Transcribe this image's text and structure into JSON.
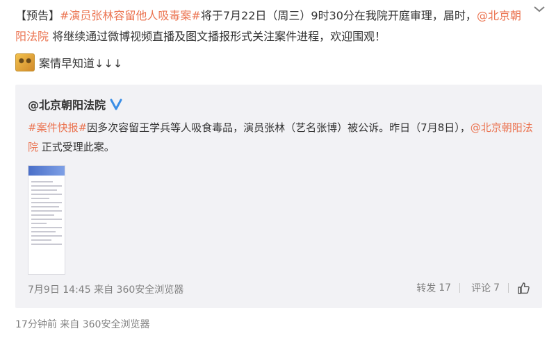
{
  "post": {
    "tag_notice": "【预告】",
    "hashtag_main": "#演员张林容留他人吸毒案#",
    "text_part1": "将于7月22日（周三）9时30分在我院开庭审理，届时，",
    "mention_court": "@北京朝阳法院",
    "text_part2": " 将继续通过微博视频直播及图文播报形式关注案件进程，欢迎围观！",
    "line3_text": "案情早知道↓↓↓",
    "emoji_name": "doge-emoji"
  },
  "repost": {
    "author": "@北京朝阳法院",
    "verified_icon": "verified-v-icon",
    "hashtag_news": "#案件快报#",
    "text_part1": "因多次容留王学兵等人吸食毒品，演员张林（艺名张博）被公诉。昨日（7月8日），",
    "mention_court": "@北京朝阳法院",
    "text_part2": " 正式受理此案。",
    "date": "7月9日 14:45",
    "source_prefix": "来自",
    "source": "360安全浏览器",
    "repost_label": "转发",
    "repost_count": "17",
    "comment_label": "评论",
    "comment_count": "7",
    "like_icon": "thumbs-up-icon"
  },
  "footer": {
    "time_ago": "17分钟前",
    "source_prefix": "来自",
    "source": "360安全浏览器"
  },
  "colors": {
    "link": "#eb7350",
    "text": "#333333",
    "meta": "#808080",
    "repost_bg": "#f2f2f5",
    "verified": "#3a8ee6"
  }
}
